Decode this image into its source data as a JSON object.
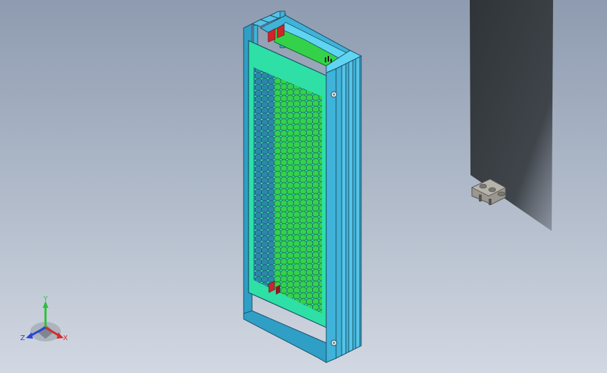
{
  "viewport": {
    "background_top": "#8e9bb0",
    "background_bottom": "#d2d8e2"
  },
  "model": {
    "housing_color": "#3fb3d9",
    "housing_edge_color": "#1c4f68",
    "front_panel_color": "#2ee0a6",
    "vent_color": "#2e87aa",
    "pcb_color": "#33d24a",
    "connector_color": "#d1232a",
    "screw_color": "#dfe6ea"
  },
  "shadow": {
    "color": "#2f3438"
  },
  "terminal_block": {
    "color": "#9a9790"
  },
  "triad": {
    "x_label": "X",
    "y_label": "Y",
    "z_label": "Z",
    "x_color": "#d42b2b",
    "y_color": "#2fbf3a",
    "z_color": "#2b46d4"
  }
}
